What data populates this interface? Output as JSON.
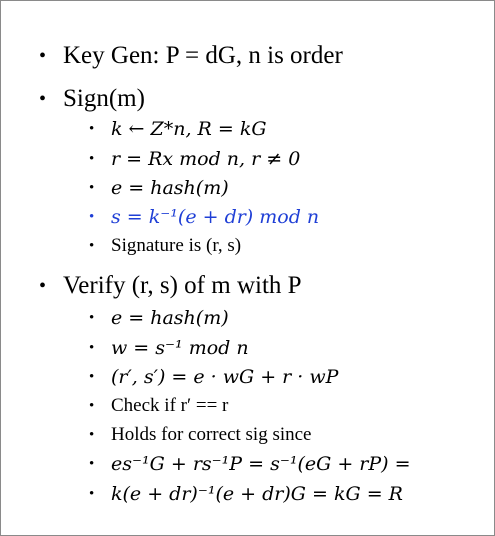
{
  "items": [
    {
      "level": 1,
      "text": "Key Gen: P = dG, n is order"
    },
    {
      "level": 1,
      "text": "Sign(m)"
    },
    {
      "level": 2,
      "text": "k ← Z*n, R = kG"
    },
    {
      "level": 2,
      "text": "r = Rx mod n, r ≠ 0"
    },
    {
      "level": 2,
      "text": "e = hash(m)"
    },
    {
      "level": 2,
      "text": "s = k⁻¹(e + dr) mod n",
      "color": "#1f3fd6"
    },
    {
      "level": 2,
      "text": "Signature is (r, s)"
    },
    {
      "level": 1,
      "text": "Verify (r, s) of m with P"
    },
    {
      "level": 2,
      "text": "e = hash(m)"
    },
    {
      "level": 2,
      "text": "w = s⁻¹ mod n"
    },
    {
      "level": 2,
      "text": "(r′, s′) = e · wG + r · wP"
    },
    {
      "level": 2,
      "text": "Check if r′ == r"
    },
    {
      "level": 2,
      "text": "Holds for correct sig since"
    },
    {
      "level": 2,
      "text": "es⁻¹G + rs⁻¹P = s⁻¹(eG + rP) ="
    },
    {
      "level": 2,
      "text": "k(e + dr)⁻¹(e + dr)G = kG = R"
    }
  ]
}
